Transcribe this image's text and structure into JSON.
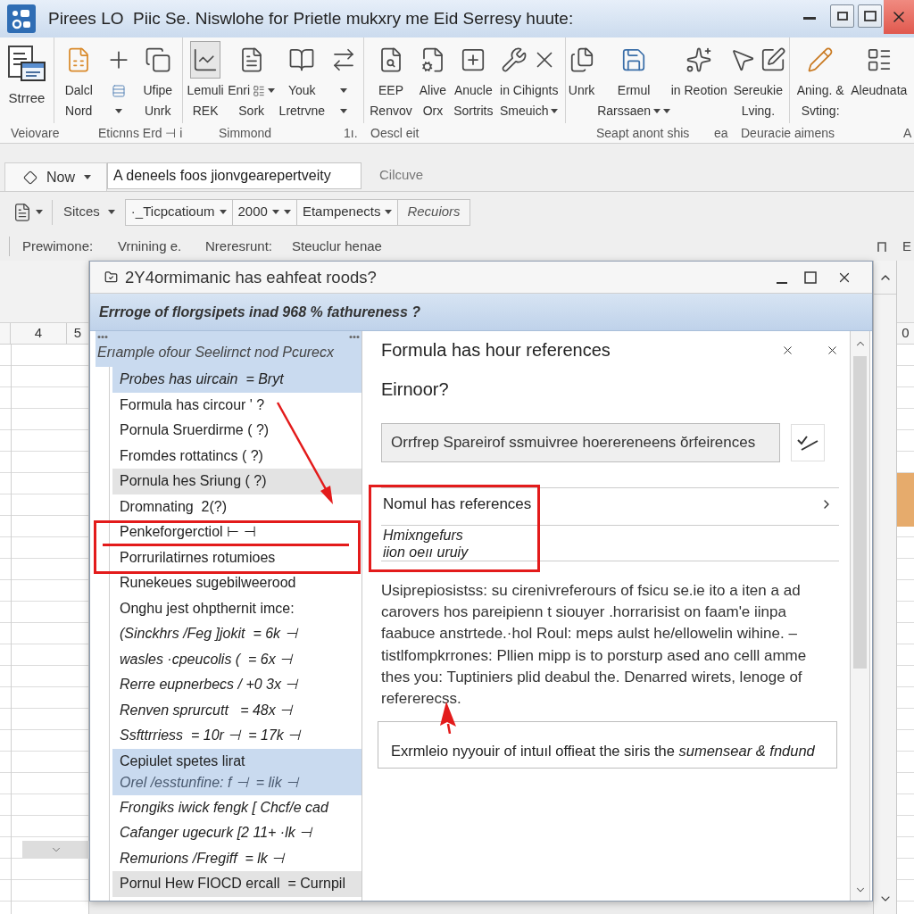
{
  "window": {
    "title": "Pirees LO  Piic Se. Niswlohe for Prietle mukxry me Eid Serresy huute:"
  },
  "ribbon": {
    "groups": [
      {
        "kind": "large",
        "items": [
          {
            "lines": [
              "Strree"
            ],
            "kind": "button",
            "pressed": false
          }
        ]
      },
      {
        "kind": "small",
        "items": [
          {
            "lines": [
              "Dalcl",
              "Nord"
            ],
            "kind": "button",
            "pressed": false
          },
          {
            "kind": "menu",
            "pressed": false
          },
          {
            "lines": [
              "Ufipe",
              "Unrk"
            ],
            "kind": "button",
            "pressed": false
          }
        ]
      },
      {
        "kind": "small",
        "items": [
          {
            "lines": [
              "Lemuli",
              "REK"
            ],
            "kind": "button",
            "pressed": true
          },
          {
            "lines": [
              "Enri",
              "Sork"
            ],
            "kind": "inline_menu",
            "pressed": false
          },
          {
            "lines": [
              "Youk",
              "Lretrvne"
            ],
            "kind": "button",
            "pressed": false
          },
          {
            "kind": "caret_pair",
            "pressed": false
          }
        ]
      },
      {
        "kind": "small",
        "items": [
          {
            "lines": [
              "EEP",
              "Renvov"
            ],
            "kind": "button",
            "pressed": false
          },
          {
            "lines": [
              "Alive",
              "Orx"
            ],
            "kind": "button",
            "pressed": false
          },
          {
            "lines": [
              "Anucle",
              "Sortrits"
            ],
            "kind": "button",
            "pressed": false
          },
          {
            "lines": [
              "in Cihignts",
              "Smeuich"
            ],
            "kind": "menu",
            "pressed": false
          }
        ]
      },
      {
        "kind": "small",
        "items": [
          {
            "lines": [
              "Unrk"
            ],
            "kind": "button",
            "pressed": false
          },
          {
            "lines": [
              "Ermul",
              "Rarssaen"
            ],
            "kind": "double_menu",
            "pressed": false
          },
          {
            "lines": [
              "in Reotion"
            ],
            "kind": "button",
            "pressed": false
          },
          {
            "lines": [
              "Sereukie",
              "Lving."
            ],
            "kind": "button",
            "pressed": false
          }
        ]
      },
      {
        "kind": "small",
        "items": [
          {
            "lines": [
              "Aning. &",
              "Svting:"
            ],
            "kind": "button",
            "pressed": false
          },
          {
            "lines": [
              "Aleudnata"
            ],
            "kind": "button",
            "pressed": false
          }
        ]
      }
    ],
    "footer": [
      "Veiovare",
      "Eticnns Erd ⊣ i",
      "Simmond",
      "1ı.",
      "Oescl eit",
      "Seapt anont shis",
      "ea",
      "Deuracie aimens",
      "A"
    ]
  },
  "toolbar": {
    "view_button": {
      "label": "Now"
    },
    "address": {
      "value": "A deneels foos jionvgearepertveity"
    },
    "caption": "Cilcuve",
    "style_menu": {
      "label": "Sitces"
    },
    "combos": [
      {
        "label": "·_Ticpcatioum",
        "kind": "dropdown"
      },
      {
        "label": "2000",
        "kind": "spinner"
      },
      {
        "label": "Etampenects",
        "kind": "dropdown"
      }
    ],
    "button": {
      "label": "Recuiors"
    },
    "status": [
      "Prewimone:",
      "Vrnining e.",
      "Nreresrunt:",
      "Steuclur henae"
    ],
    "status_end": "E"
  },
  "sheet": {
    "column_headers": [
      "4",
      "5"
    ],
    "right_column_header": "0"
  },
  "dialog": {
    "title": "2Y4ormimanic has eahfeat roods?",
    "banner": "Errroge of florgsipets inad 968 % fathureness ?",
    "list": {
      "heading": "Erıample ofour Seelirnct nod Pcurecx",
      "items": [
        {
          "text": "Probes has uircain  = Bryt",
          "kind": "formula",
          "selected": true,
          "shaded": false
        },
        {
          "text": "Formula has circour ' ?",
          "kind": "entry",
          "selected": false,
          "shaded": false
        },
        {
          "text": "Pornula Sruerdirme ( ?)",
          "kind": "entry",
          "selected": false,
          "shaded": false
        },
        {
          "text": "Fromdes rottatincs ( ?)",
          "kind": "entry",
          "selected": false,
          "shaded": false
        },
        {
          "text": "Pornula hes Sriung ( ?)",
          "kind": "entry",
          "selected": false,
          "shaded": true
        },
        {
          "text": "Dromnating  2(?)",
          "kind": "entry",
          "selected": false,
          "shaded": false
        },
        {
          "text": "Penkeforgerctiol ⊢ ⊣",
          "kind": "entry",
          "selected": false,
          "shaded": false
        },
        {
          "text": "Porrurilatirnes rotumioes",
          "kind": "entry",
          "selected": false,
          "shaded": false
        },
        {
          "text": "Runekeues sugebilweerood",
          "kind": "entry",
          "selected": false,
          "shaded": false
        },
        {
          "text": "Onghu jest ohpthernit imce:",
          "kind": "entry",
          "selected": false,
          "shaded": false
        },
        {
          "text": "(Sinckhrs /Feg ]jokit  = 6k ⊣",
          "kind": "formula",
          "selected": false,
          "shaded": false
        },
        {
          "text": "wasles ·cpeucolis (  = 6x ⊣",
          "kind": "formula",
          "selected": false,
          "shaded": false
        },
        {
          "text": "Rerre eupnerbecs / +0 3x ⊣",
          "kind": "formula",
          "selected": false,
          "shaded": false
        },
        {
          "text": "Renven sprurcutt   = 48x ⊣",
          "kind": "formula",
          "selected": false,
          "shaded": false
        },
        {
          "text": "Ssfttrriess  = 10r ⊣  = 17k ⊣",
          "kind": "formula",
          "selected": false,
          "shaded": false
        },
        {
          "text": "Cepiulet spetes lirat",
          "detail": "Orel /esstunfine: f ⊣  = lik ⊣",
          "kind": "entry",
          "selected": true,
          "shaded": false
        },
        {
          "text": "Frongiks iwick fengk [ Chcf/e cad",
          "kind": "formula",
          "selected": false,
          "shaded": false
        },
        {
          "text": "Cafanger ugecurk [2 11+ ·lk ⊣",
          "kind": "formula",
          "selected": false,
          "shaded": false
        },
        {
          "text": "Remurions /Fregiff  = lk ⊣",
          "kind": "formula",
          "selected": false,
          "shaded": false
        },
        {
          "text": "Pornul Hew FIOCD ercall  = Curnpil",
          "kind": "entry",
          "selected": false,
          "shaded": true
        }
      ]
    },
    "detail": {
      "heading": "Formula has hour references",
      "question": "Eirnoor?",
      "field": {
        "value": "Orrfrep Spareirof ssmuivree hoerereneens ŏrfeirences"
      },
      "options": [
        {
          "kind": "link",
          "title": "Nomul has references"
        },
        {
          "kind": "note",
          "title": "Hmixngefurs",
          "subtitle": "iion oeıı uruiy"
        }
      ],
      "description": "Usiprepiosistss: su cirenivreferours of fsicu se.ie ito a iten a ad carovers hos pareipienn t siouyer .horrarisist on faam'e iinpa faabuce anstrtede.·hol Roul: meps aulst he/ellowelin wihine. – tistlfompkrrones: Pllien mipp is to porsturp ased ano celll amme thes you: Tuptiniers plid deabul the. Denarred wirets, lenoge of refererecss.",
      "example": "Exrmleio nyyouir of intuıl offieat the siris the *sumensear & fndund*"
    }
  }
}
